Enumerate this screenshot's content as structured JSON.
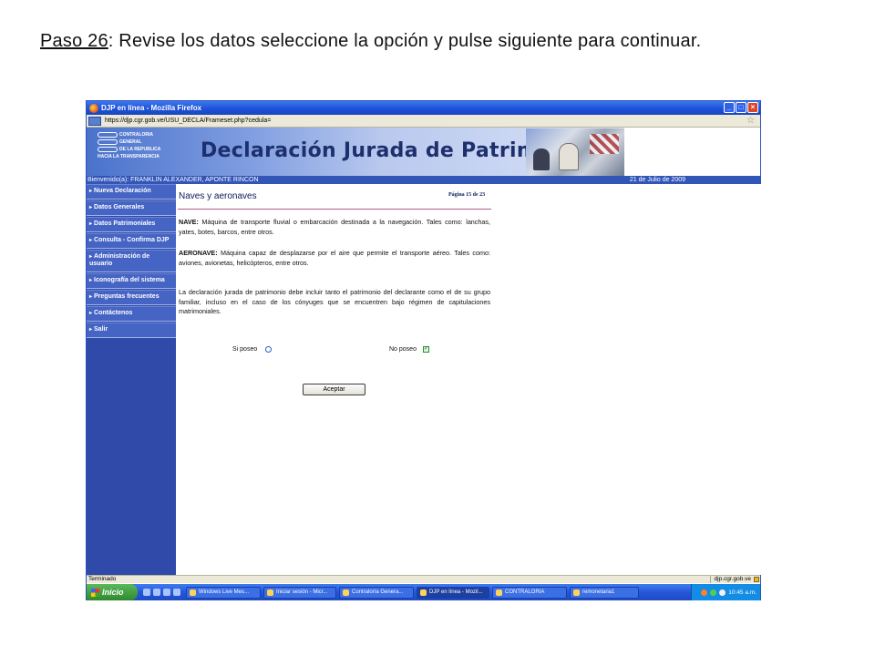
{
  "slide": {
    "step": "Paso 26",
    "instruction": ":  Revise los datos seleccione la opción y pulse siguiente para continuar."
  },
  "window": {
    "title": "DJP en línea - Mozilla Firefox",
    "url": "https://djp.cgr.gob.ve/USU_DECLA/Frameset.php?cedula="
  },
  "banner": {
    "logo_lines": [
      "CONTRALORIA",
      "GENERAL",
      "DE LA REPUBLICA",
      "HACIA LA TRANSPARENCIA"
    ],
    "title": "Declaración Jurada de Patrimonio"
  },
  "welcome": {
    "user": "Bienvenido(a): FRANKLIN ALEXANDER, APONTE RINCON",
    "date": "21 de Julio de 2009"
  },
  "sidebar": {
    "items": [
      {
        "label": "Nueva Declaración"
      },
      {
        "label": "Datos Generales"
      },
      {
        "label": "Datos Patrimoniales"
      },
      {
        "label": "Consulta - Confirma DJP"
      },
      {
        "label": "Administración de usuario"
      },
      {
        "label": "Iconografía del sistema"
      },
      {
        "label": "Preguntas frecuentes"
      },
      {
        "label": "Contáctenos"
      },
      {
        "label": "Salir"
      }
    ]
  },
  "content": {
    "heading": "Naves y aeronaves",
    "page": "Página 15 de 23",
    "nave_term": "NAVE:",
    "nave_def": " Máquina de transporte fluvial o embarcación destinada a la navegación. Tales como: lanchas, yates, botes, barcos, entre otros.",
    "aeronave_term": "AERONAVE:",
    "aeronave_def": " Máquina capaz de desplazarse por el aire que permite el transporte aéreo. Tales como: aviones, avionetas, helicópteros, entre otros.",
    "note": "La declaración jurada de patrimonio debe incluir tanto el patrimonio del declarante como el de su grupo familiar, incluso en el caso de los cónyuges que se encuentren bajo régimen de capitulaciones matrimoniales.",
    "option_yes": "Si poseo",
    "option_no": "No poseo",
    "accept_label": "Aceptar"
  },
  "statusbar": {
    "status": "Terminado",
    "domain": "djp.cgr.gob.ve"
  },
  "taskbar": {
    "start": "Inicio",
    "tasks": [
      {
        "label": "Windows Live Mes..."
      },
      {
        "label": "Iniciar sesión - Micr..."
      },
      {
        "label": "Contraloría Genera..."
      },
      {
        "label": "DJP en línea - Mozil..."
      },
      {
        "label": "CONTRALORIA"
      },
      {
        "label": "remonetaria1"
      }
    ],
    "clock": "10:45 a.m."
  }
}
